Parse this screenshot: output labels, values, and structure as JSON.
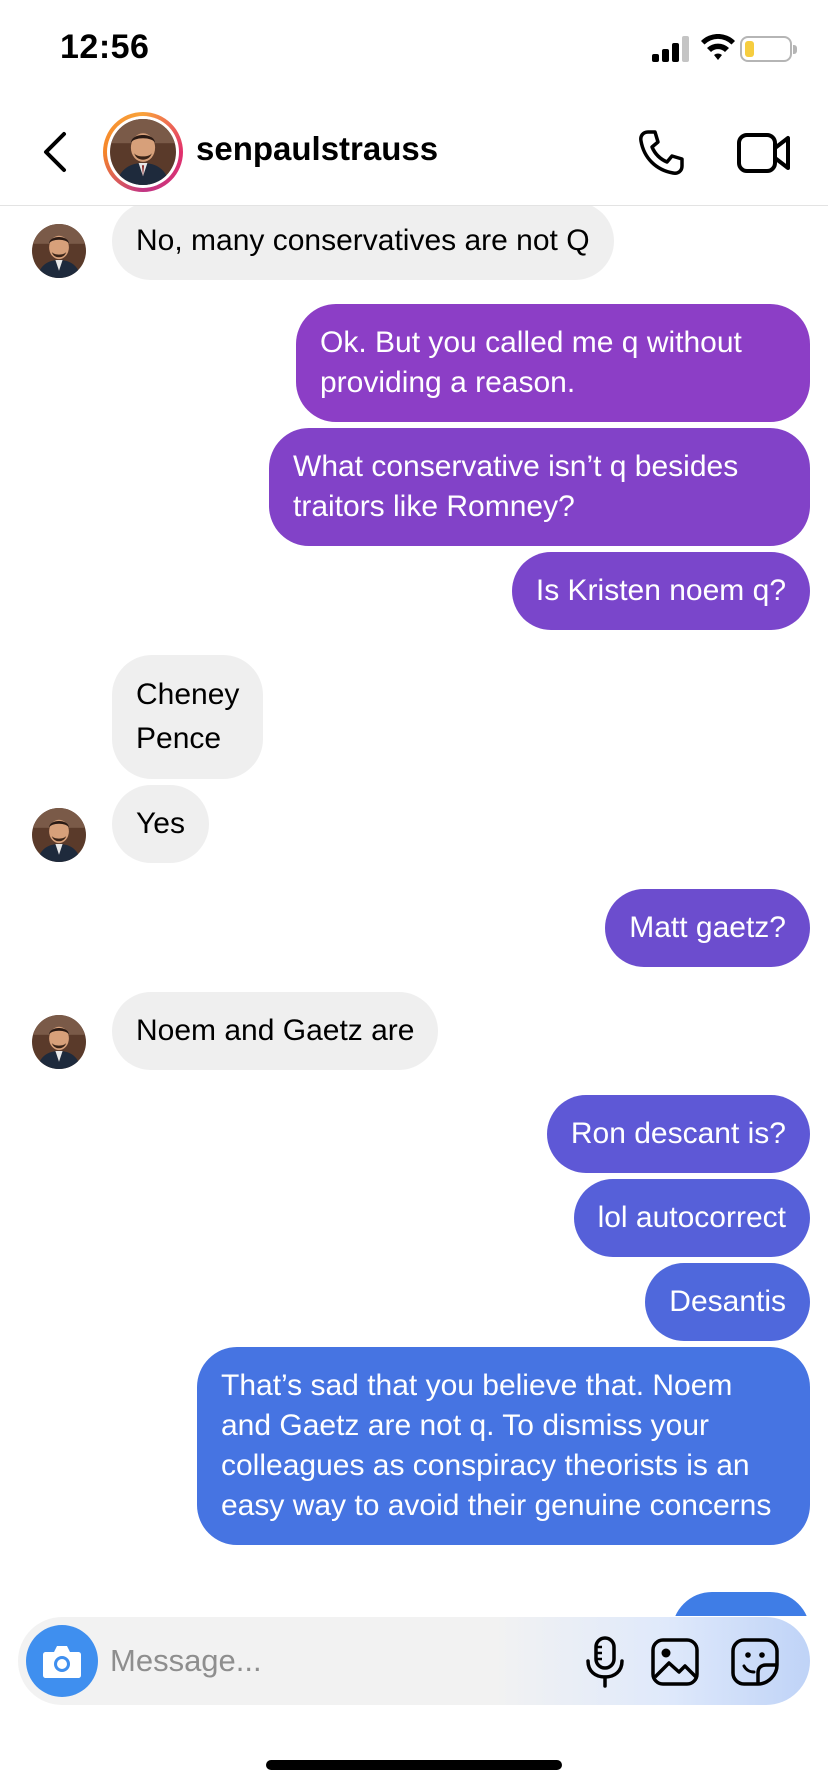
{
  "status_bar": {
    "time": "12:56"
  },
  "header": {
    "username": "senpaulstrauss"
  },
  "messages": [
    {
      "side": "in",
      "text": "No, many conservatives are not Q"
    },
    {
      "side": "out",
      "text": "Ok. But you called me q without providing a reason."
    },
    {
      "side": "out",
      "text": "What conservative isn’t q besides traitors like Romney?"
    },
    {
      "side": "out",
      "text": "Is Kristen noem q?"
    },
    {
      "side": "in",
      "text": "Cheney\nPence"
    },
    {
      "side": "in",
      "text": "Yes"
    },
    {
      "side": "out",
      "text": "Matt gaetz?"
    },
    {
      "side": "in",
      "text": "Noem and Gaetz are"
    },
    {
      "side": "out",
      "text": "Ron descant is?"
    },
    {
      "side": "out",
      "text": "lol autocorrect"
    },
    {
      "side": "out",
      "text": "Desantis"
    },
    {
      "side": "out",
      "text": "That’s sad that you believe that. Noem and Gaetz are not q. To dismiss your colleagues as conspiracy theorists is an easy way to avoid their genuine concerns"
    }
  ],
  "composer": {
    "placeholder": "Message..."
  },
  "colors": {
    "incoming_bubble": "#efefef",
    "outgoing_gradient_top": "#8a3ec6",
    "outgoing_gradient_bottom": "#3c7de6",
    "camera_button": "#3f8fef"
  },
  "icons": [
    "back-icon",
    "phone-icon",
    "video-camera-icon",
    "camera-icon",
    "microphone-icon",
    "gallery-icon",
    "sticker-icon"
  ]
}
